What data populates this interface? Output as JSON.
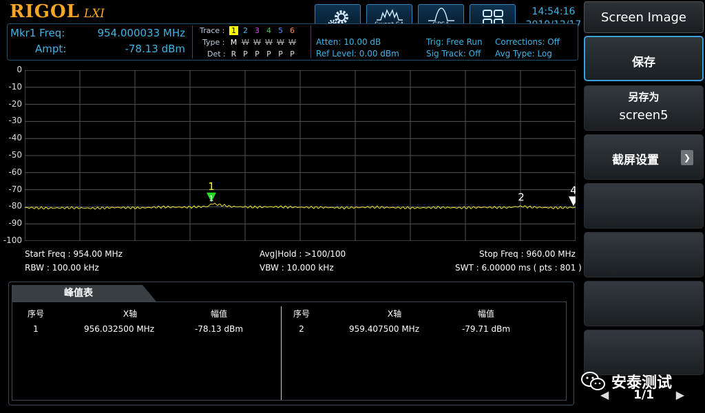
{
  "header": {
    "brand": "RIGOL",
    "brand_sub": "LXI",
    "modes": [
      {
        "label": "",
        "icon": "settings-gears-icon"
      },
      {
        "label": "Swept SA",
        "icon": "swept-sa-icon"
      },
      {
        "label": "GPSA",
        "icon": "gpsa-icon"
      },
      {
        "label": "",
        "icon": "window-layout-icon"
      }
    ],
    "time": "14:54:16",
    "date": "2019/12/17"
  },
  "marker": {
    "freq_label": "Mkr1 Freq:",
    "freq_value": "954.000033 MHz",
    "ampt_label": "Ampt:",
    "ampt_value": "-78.13 dBm"
  },
  "traces": {
    "trace_label": "Trace :",
    "type_label": "Type :",
    "det_label": "Det :",
    "numbers": [
      "1",
      "2",
      "3",
      "4",
      "5",
      "6"
    ],
    "colors": [
      "#ffff00",
      "#3db4e8",
      "#e040fb",
      "#35d046",
      "#4f8cff",
      "#ff8a30"
    ],
    "types": [
      "M",
      "W",
      "W",
      "W",
      "W",
      "W"
    ],
    "dets": [
      "R",
      "P",
      "P",
      "P",
      "P",
      "P"
    ]
  },
  "settings": {
    "atten": "Atten: 10.00 dB",
    "ref_level": "Ref Level: 0.00 dBm",
    "trig": "Trig: Free Run",
    "sig_track": "Sig Track: Off",
    "corrections": "Corrections: Off",
    "avg_type": "Avg Type: Log"
  },
  "chart_data": {
    "type": "line",
    "xlim": [
      954.0,
      960.0
    ],
    "ylim": [
      -100,
      0
    ],
    "y_ticks": [
      "0",
      "-10",
      "-20",
      "-30",
      "-40",
      "-50",
      "-60",
      "-70",
      "-80",
      "-90",
      "-100"
    ],
    "grid": true,
    "series": [
      {
        "x": [
          954.0,
          954.25,
          954.5,
          954.75,
          955.0,
          955.25,
          955.5,
          955.75,
          956.0,
          956.0325,
          956.25,
          956.5,
          956.75,
          957.0,
          957.25,
          957.5,
          957.75,
          958.0,
          958.25,
          958.5,
          958.75,
          959.0,
          959.25,
          959.4075,
          959.5,
          959.75,
          960.0
        ],
        "y": [
          -80.5,
          -80.8,
          -80.6,
          -80.9,
          -80.4,
          -80.7,
          -80.1,
          -80.3,
          -79.8,
          -78.13,
          -79.9,
          -80.2,
          -80.0,
          -80.3,
          -80.4,
          -80.6,
          -80.2,
          -80.5,
          -80.7,
          -80.4,
          -80.6,
          -80.3,
          -80.5,
          -79.71,
          -80.2,
          -80.6,
          -80.4
        ]
      }
    ],
    "markers": [
      {
        "label": "1",
        "x": 956.0325,
        "y": -78.13,
        "color": "#22dd22",
        "active": true
      },
      {
        "label": "2",
        "x": 959.4075,
        "y": -79.71,
        "color": "#ffffff",
        "active": false
      },
      {
        "label": "4",
        "x": 959.98,
        "y": -80.4,
        "color": "#ffffff",
        "active": false
      }
    ]
  },
  "scan": {
    "start_freq": "Start Freq : 954.00 MHz",
    "rbw": "RBW : 100.00 kHz",
    "avg_hold": "Avg|Hold : >100/100",
    "vbw": "VBW : 10.000 kHz",
    "stop_freq": "Stop Freq : 960.00 MHz",
    "swt": "SWT : 6.00000 ms ( pts : 801 )"
  },
  "peak_table": {
    "title": "峰值表",
    "headers": [
      "序号",
      "X轴",
      "幅值"
    ],
    "rows": [
      {
        "index": "1",
        "x": "956.032500 MHz",
        "amplitude": "-78.13 dBm"
      },
      {
        "index": "2",
        "x": "959.407500 MHz",
        "amplitude": "-79.71 dBm"
      }
    ]
  },
  "menu": {
    "title": "Screen Image",
    "save": "保存",
    "save_as_label": "另存为",
    "save_as_value": "screen5",
    "screenshot_settings": "截屏设置",
    "page": "1/1"
  },
  "watermark": "安泰测试"
}
